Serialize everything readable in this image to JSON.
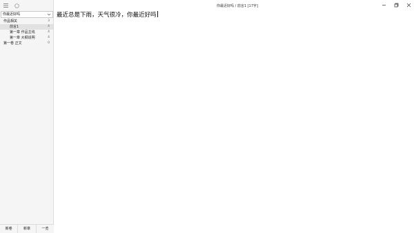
{
  "sidebar": {
    "book_selector": {
      "selected": "你最近好吗"
    },
    "tree": [
      {
        "label": "作品相关",
        "count": "3",
        "level": 0,
        "selected": false
      },
      {
        "label": "前言1",
        "count": "4",
        "level": 1,
        "selected": true
      },
      {
        "label": "第一章 作品主线",
        "count": "4",
        "level": 1,
        "selected": false
      },
      {
        "label": "第一章 大纲说明",
        "count": "4",
        "level": 1,
        "selected": false
      },
      {
        "label": "第一卷 正文",
        "count": "0",
        "level": 0,
        "selected": false
      }
    ],
    "bottom_buttons": [
      "新卷",
      "新章",
      "一览"
    ]
  },
  "titlebar": {
    "title": "你最近好吗 / 前言1 [17字]"
  },
  "editor": {
    "content": "最近总是下雨，天气很冷，你最近好吗"
  },
  "icons": {
    "menu": "hamburger-menu-icon",
    "theme": "circle-icon",
    "minimize": "minimize-icon",
    "restore": "restore-icon",
    "close": "close-icon"
  }
}
